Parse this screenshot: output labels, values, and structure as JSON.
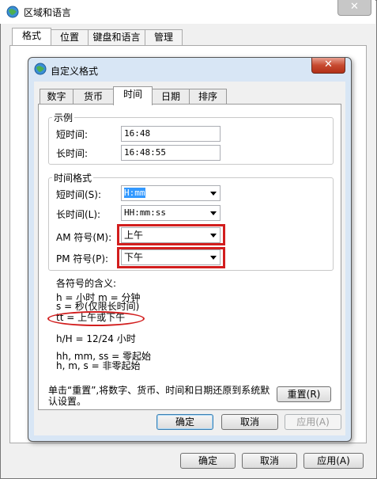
{
  "outer": {
    "title": "区域和语言",
    "close": "✕",
    "tabs": [
      "格式",
      "位置",
      "键盘和语言",
      "管理"
    ],
    "buttons": {
      "ok": "确定",
      "cancel": "取消",
      "apply": "应用(A)"
    }
  },
  "dialog": {
    "title": "自定义格式",
    "close": "✕",
    "tabs": [
      "数字",
      "货币",
      "时间",
      "日期",
      "排序"
    ],
    "sample": {
      "group": "示例",
      "short_label": "短时间:",
      "short_value": "16:48",
      "long_label": "长时间:",
      "long_value": "16:48:55"
    },
    "formats": {
      "group": "时间格式",
      "short_label": "短时间(S):",
      "short_value": "H:mm",
      "long_label": "长时间(L):",
      "long_value": "HH:mm:ss",
      "am_label": "AM 符号(M):",
      "am_value": "上午",
      "pm_label": "PM 符号(P):",
      "pm_value": "下午"
    },
    "legend": {
      "heading": "各符号的含义:",
      "lines": [
        "h = 小时   m = 分钟",
        "s = 秒(仅限长时间)",
        "tt = 上午或下午",
        "h/H = 12/24 小时",
        "hh, mm, ss = 零起始",
        "h, m, s = 非零起始"
      ]
    },
    "reset_note": "单击“重置”,将数字、货币、时间和日期还原到系统默认设置。",
    "reset_button": "重置(R)",
    "buttons": {
      "ok": "确定",
      "cancel": "取消",
      "apply": "应用(A)"
    }
  },
  "colors": {
    "highlight": "#d21e1e",
    "selection": "#3399ff"
  }
}
